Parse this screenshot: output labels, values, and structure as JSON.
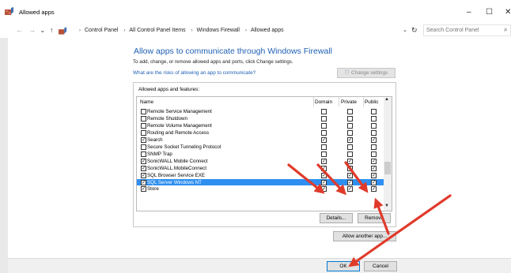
{
  "window": {
    "title": "Allowed apps",
    "minimize": "–",
    "maximize": "☐",
    "close": "✕"
  },
  "address": {
    "back": "←",
    "forward": "→",
    "up": "↑",
    "breadcrumb": [
      "Control Panel",
      "All Control Panel Items",
      "Windows Firewall",
      "Allowed apps"
    ],
    "dropdown": "⌄",
    "refresh": "↻",
    "search_placeholder": "Search Control Panel",
    "search_icon": "⌕"
  },
  "main": {
    "heading": "Allow apps to communicate through Windows Firewall",
    "subtext": "To add, change, or remove allowed apps and ports, click Change settings.",
    "risk_link": "What are the risks of allowing an app to communicate?",
    "change_settings": "Change settings",
    "group_label": "Allowed apps and features:",
    "columns": [
      "Name",
      "Domain",
      "Private",
      "Public"
    ],
    "apps": [
      {
        "name": "Remote Service Management",
        "enabled": false,
        "domain": false,
        "private": false,
        "public": false
      },
      {
        "name": "Remote Shutdown",
        "enabled": false,
        "domain": false,
        "private": false,
        "public": false
      },
      {
        "name": "Remote Volume Management",
        "enabled": false,
        "domain": false,
        "private": false,
        "public": false
      },
      {
        "name": "Routing and Remote Access",
        "enabled": false,
        "domain": false,
        "private": false,
        "public": false
      },
      {
        "name": "Search",
        "enabled": true,
        "domain": true,
        "private": true,
        "public": true
      },
      {
        "name": "Secure Socket Tunneling Protocol",
        "enabled": false,
        "domain": false,
        "private": false,
        "public": false
      },
      {
        "name": "SNMP Trap",
        "enabled": false,
        "domain": false,
        "private": false,
        "public": false
      },
      {
        "name": "SonicWALL Mobile Connect",
        "enabled": true,
        "domain": true,
        "private": true,
        "public": true
      },
      {
        "name": "SonicWALL.MobileConnect",
        "enabled": true,
        "domain": true,
        "private": true,
        "public": true
      },
      {
        "name": "SQL Browser Service EXE",
        "enabled": true,
        "domain": true,
        "private": true,
        "public": true
      },
      {
        "name": "SQL Server Windows NT",
        "enabled": true,
        "domain": true,
        "private": true,
        "public": true,
        "selected": true
      },
      {
        "name": "Store",
        "enabled": true,
        "domain": true,
        "private": true,
        "public": true
      }
    ],
    "details": "Details...",
    "remove": "Remove",
    "allow_another": "Allow another app...",
    "ok": "OK",
    "cancel": "Cancel"
  },
  "colors": {
    "accent": "#1e5fb3",
    "selection": "#2f8ff0",
    "annotation_arrow": "#e03a2b"
  },
  "icons": {
    "app": "firewall-icon",
    "shield": "uac-shield-icon",
    "up_scroll": "▲",
    "down_scroll": "▼"
  }
}
